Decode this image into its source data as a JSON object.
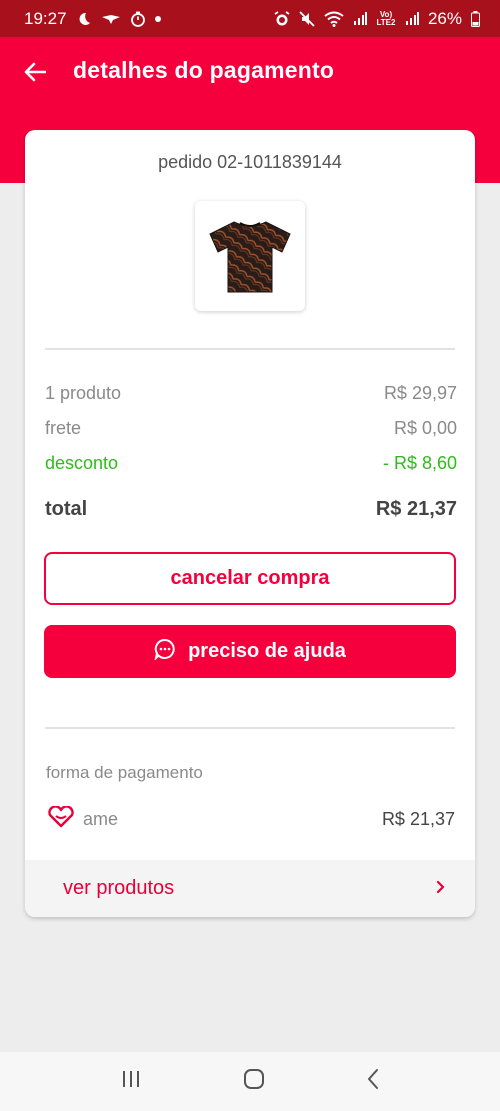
{
  "status_bar": {
    "time": "19:27",
    "battery": "26%",
    "network_label": "Vo) LTE2",
    "left_icons": [
      "moon-icon",
      "bird-icon",
      "timer-icon",
      "dot-icon"
    ],
    "right_icons": [
      "alarm-icon",
      "mute-icon",
      "wifi-icon",
      "signal-icon",
      "signal-icon",
      "battery-icon"
    ]
  },
  "header": {
    "title": "detalhes do pagamento",
    "back_icon": "arrow-left-icon"
  },
  "order": {
    "id_label": "pedido 02-1011839144",
    "image": "t-shirt-product-image"
  },
  "summary": {
    "rows": [
      {
        "label": "1 produto",
        "value": "R$ 29,97"
      },
      {
        "label": "frete",
        "value": "R$ 0,00"
      },
      {
        "label": "desconto",
        "value": "- R$ 8,60"
      }
    ],
    "total_label": "total",
    "total_value": "R$ 21,37"
  },
  "actions": {
    "cancel_label": "cancelar compra",
    "help_label": "preciso de ajuda",
    "help_icon": "chat-icon"
  },
  "payment": {
    "section_label": "forma de pagamento",
    "method_label": "ame",
    "method_icon": "heart-icon",
    "amount": "R$ 21,37"
  },
  "footer": {
    "link_label": "ver produtos",
    "link_icon": "chevron-right-icon"
  },
  "nav": {
    "icons": [
      "recent-apps-icon",
      "home-icon",
      "back-icon"
    ]
  },
  "colors": {
    "brand": "#f5003d",
    "status_bar": "#a8101c",
    "discount": "#2fbb1c"
  }
}
